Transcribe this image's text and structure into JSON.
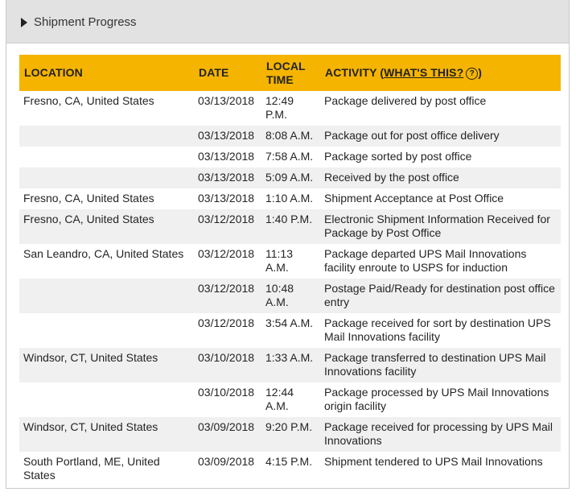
{
  "panel": {
    "title": "Shipment Progress"
  },
  "table": {
    "headers": {
      "location": "LOCATION",
      "date": "DATE",
      "time": "LOCAL TIME",
      "activity": "ACTIVITY (",
      "whats_this": "WHAT'S THIS?",
      "help_icon": "?",
      "close_paren": ")"
    },
    "rows": [
      {
        "location": "Fresno, CA,   United States",
        "date": "03/13/2018",
        "time": "12:49 P.M.",
        "activity": "Package delivered by post office"
      },
      {
        "location": "",
        "date": "03/13/2018",
        "time": "8:08 A.M.",
        "activity": "Package out for post office delivery"
      },
      {
        "location": "",
        "date": "03/13/2018",
        "time": "7:58 A.M.",
        "activity": "Package sorted by post office"
      },
      {
        "location": "",
        "date": "03/13/2018",
        "time": "5:09 A.M.",
        "activity": "Received by the post office"
      },
      {
        "location": "Fresno, CA, United States",
        "date": "03/13/2018",
        "time": "1:10 A.M.",
        "activity": "Shipment Acceptance at Post Office"
      },
      {
        "location": "Fresno, CA, United States",
        "date": "03/12/2018",
        "time": "1:40 P.M.",
        "activity": "Electronic Shipment Information Received for Package by Post Office"
      },
      {
        "location": "San Leandro, CA, United States",
        "date": "03/12/2018",
        "time": "11:13 A.M.",
        "activity": "Package departed UPS Mail Innovations facility enroute to USPS for induction"
      },
      {
        "location": "",
        "date": "03/12/2018",
        "time": "10:48 A.M.",
        "activity": "Postage Paid/Ready for destination post office entry"
      },
      {
        "location": "",
        "date": "03/12/2018",
        "time": "3:54 A.M.",
        "activity": "Package received for sort by destination UPS Mail Innovations facility"
      },
      {
        "location": "Windsor, CT, United States",
        "date": "03/10/2018",
        "time": "1:33 A.M.",
        "activity": "Package transferred to destination UPS Mail Innovations facility"
      },
      {
        "location": "",
        "date": "03/10/2018",
        "time": "12:44 A.M.",
        "activity": "Package processed by UPS Mail Innovations origin facility"
      },
      {
        "location": "Windsor, CT, United States",
        "date": "03/09/2018",
        "time": "9:20 P.M.",
        "activity": "Package received for processing by UPS Mail Innovations"
      },
      {
        "location": "South Portland, ME, United States",
        "date": "03/09/2018",
        "time": "4:15 P.M.",
        "activity": "Shipment tendered to UPS Mail Innovations"
      }
    ]
  },
  "colors": {
    "header_accent": "#f5b400",
    "row_stripe": "#f0f0f0",
    "panel_bar": "#e2e2e2"
  },
  "icons": {
    "toggle": "caret-right-icon",
    "help": "question-circle-icon"
  }
}
